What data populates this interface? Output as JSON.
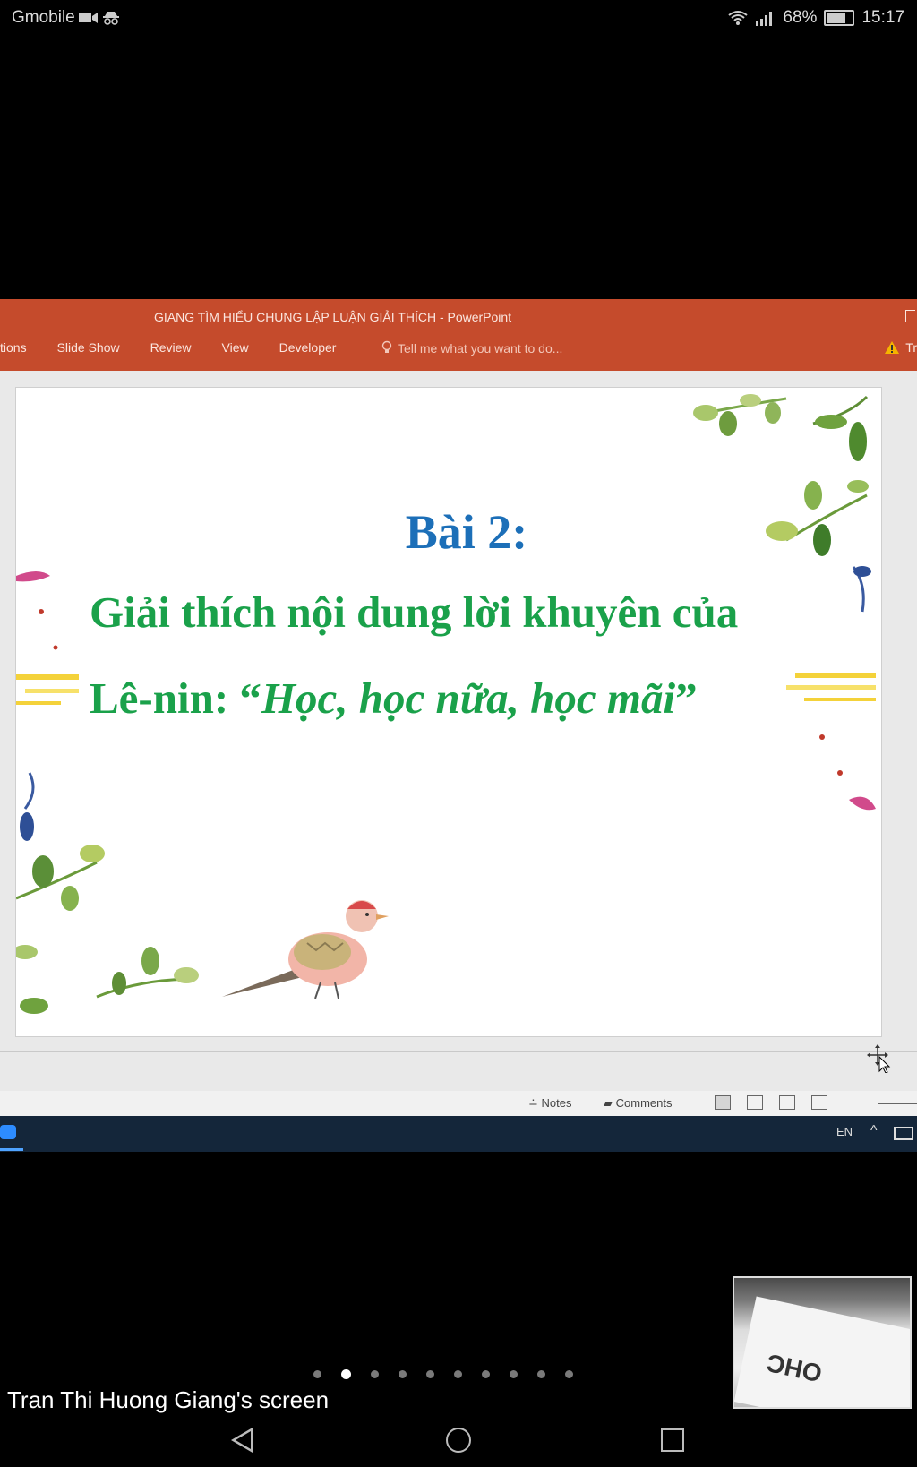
{
  "status_bar": {
    "carrier": "Gmobile",
    "icons": [
      "video-camera-icon",
      "incognito-icon",
      "wifi-icon",
      "signal-icon",
      "battery-icon"
    ],
    "battery_percent": "68%",
    "battery_level": 0.68,
    "time": "15:17"
  },
  "powerpoint": {
    "window_title": "GIANG TÌM HIỂU CHUNG LẬP LUẬN GIẢI THÍCH - PowerPoint",
    "ribbon_tabs": [
      "tions",
      "Slide Show",
      "Review",
      "View",
      "Developer"
    ],
    "tell_me": "Tell me what you want to do...",
    "warning_label": "Tr",
    "slide": {
      "title": "Bài 2:",
      "line1": "Giải thích nội dung lời khuyên của",
      "line2_prefix": "Lê-nin: “",
      "line2_quote": "Học, học nữa, học mãi",
      "line2_suffix": "”"
    },
    "status": {
      "notes_label": "Notes",
      "comments_label": "Comments"
    }
  },
  "taskbar": {
    "language": "EN"
  },
  "meeting": {
    "screen_owner": "Tran Thi Huong Giang's screen",
    "page_count": 10,
    "active_page": 2,
    "self_view_text": "OHC"
  },
  "colors": {
    "ppt_accent": "#c54b2c",
    "slide_title": "#1c6fb8",
    "slide_text": "#1aa14a"
  }
}
